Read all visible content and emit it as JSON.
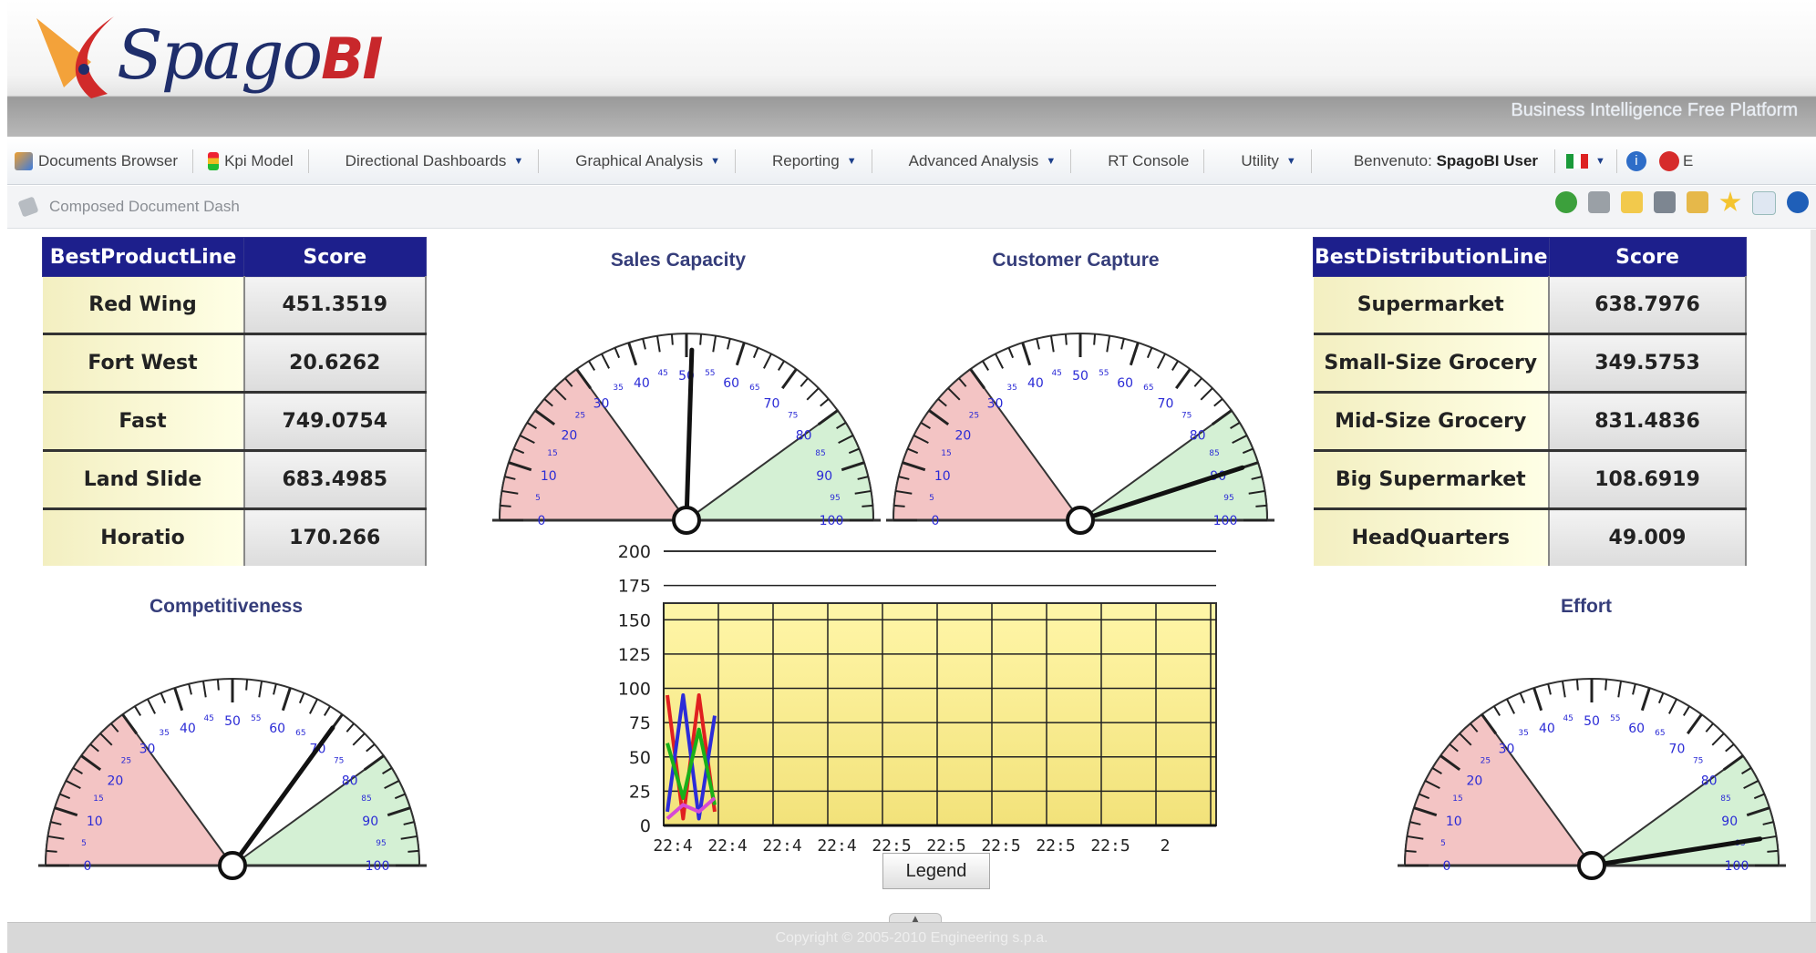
{
  "header": {
    "logo_text": "Spago",
    "logo_bi": "BI",
    "tagline": "Business Intelligence Free Platform"
  },
  "menu": {
    "items": [
      {
        "label": "Documents Browser",
        "dropdown": false,
        "icon": "documents-icon"
      },
      {
        "label": "Kpi Model",
        "dropdown": false,
        "icon": "traffic-light-icon"
      },
      {
        "label": "Directional Dashboards",
        "dropdown": true
      },
      {
        "label": "Graphical Analysis",
        "dropdown": true
      },
      {
        "label": "Reporting",
        "dropdown": true
      },
      {
        "label": "Advanced Analysis",
        "dropdown": true
      },
      {
        "label": "RT Console",
        "dropdown": false
      },
      {
        "label": "Utility",
        "dropdown": true
      }
    ],
    "welcome_prefix": "Benvenuto:",
    "welcome_user": "SpagoBI User",
    "exit_label": "E"
  },
  "breadcrumb": {
    "label": "Composed Document Dash"
  },
  "toolbar_icons": [
    "refresh-icon",
    "copy-icon",
    "sticky-note-icon",
    "print-icon",
    "export-icon",
    "favorite-icon",
    "notes-icon",
    "info-icon"
  ],
  "product_table": {
    "headers": [
      "BestProductLine",
      "Score"
    ],
    "rows": [
      [
        "Red Wing",
        "451.3519"
      ],
      [
        "Fort West",
        "20.6262"
      ],
      [
        "Fast",
        "749.0754"
      ],
      [
        "Land Slide",
        "683.4985"
      ],
      [
        "Horatio",
        "170.266"
      ]
    ]
  },
  "distribution_table": {
    "headers": [
      "BestDistributionLine",
      "Score"
    ],
    "rows": [
      [
        "Supermarket",
        "638.7976"
      ],
      [
        "Small-Size Grocery",
        "349.5753"
      ],
      [
        "Mid-Size Grocery",
        "831.4836"
      ],
      [
        "Big Supermarket",
        "108.6919"
      ],
      [
        "HeadQuarters",
        "49.009"
      ]
    ]
  },
  "gauges": [
    {
      "id": "sales",
      "title": "Sales Capacity",
      "value": 51
    },
    {
      "id": "capture",
      "title": "Customer Capture",
      "value": 90
    },
    {
      "id": "competitiveness",
      "title": "Competitiveness",
      "value": 70
    },
    {
      "id": "effort",
      "title": "Effort",
      "value": 95
    }
  ],
  "gauge_scale": {
    "min": 0,
    "max": 100,
    "red_to": 30,
    "green_from": 80,
    "major_labels": [
      "0",
      "10",
      "20",
      "30",
      "40",
      "50",
      "60",
      "70",
      "80",
      "90",
      "100"
    ],
    "minor_labels": [
      "5",
      "15",
      "25",
      "35",
      "45",
      "55",
      "65",
      "75",
      "85",
      "95"
    ],
    "colors": {
      "red": "#f3c4c4",
      "green": "#d4f0d4",
      "label": "#2b2bd6"
    }
  },
  "chart_data": {
    "type": "line",
    "ylim": [
      0,
      200
    ],
    "yticks": [
      "0",
      "25",
      "50",
      "75",
      "100",
      "125",
      "150",
      "175",
      "200"
    ],
    "categories": [
      "22:4",
      "22:4",
      "22:4",
      "22:4",
      "22:5",
      "22:5",
      "22:5",
      "22:5",
      "22:5",
      "2"
    ],
    "series": [
      {
        "values": [
          95,
          5,
          95,
          10
        ],
        "color": "#e02020"
      },
      {
        "values": [
          10,
          95,
          5,
          80
        ],
        "color": "#2c2cd8"
      },
      {
        "values": [
          60,
          20,
          70,
          15
        ],
        "color": "#19b019"
      },
      {
        "values": [
          5,
          15,
          10,
          20
        ],
        "color": "#d64ad6"
      }
    ],
    "legend_label": "Legend"
  },
  "footer": {
    "text": "Copyright © 2005-2010 Engineering s.p.a."
  }
}
